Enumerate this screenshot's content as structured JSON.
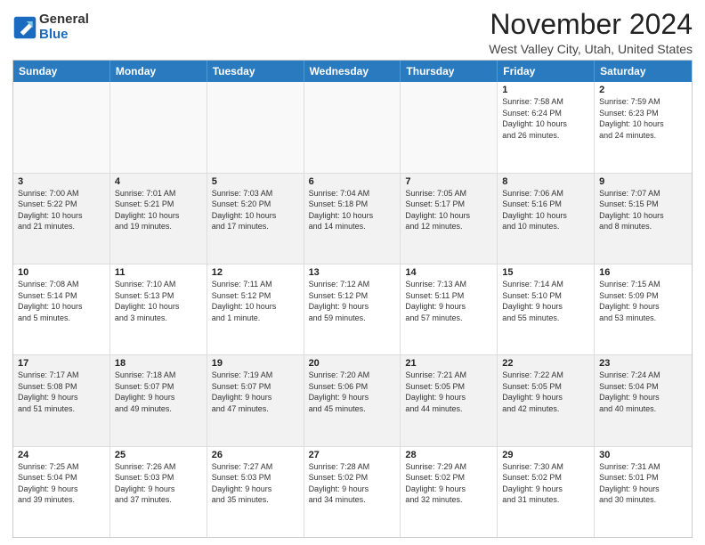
{
  "logo": {
    "general": "General",
    "blue": "Blue"
  },
  "title": "November 2024",
  "location": "West Valley City, Utah, United States",
  "header_days": [
    "Sunday",
    "Monday",
    "Tuesday",
    "Wednesday",
    "Thursday",
    "Friday",
    "Saturday"
  ],
  "weeks": [
    [
      {
        "day": "",
        "empty": true
      },
      {
        "day": "",
        "empty": true
      },
      {
        "day": "",
        "empty": true
      },
      {
        "day": "",
        "empty": true
      },
      {
        "day": "",
        "empty": true
      },
      {
        "day": "1",
        "info": "Sunrise: 7:58 AM\nSunset: 6:24 PM\nDaylight: 10 hours\nand 26 minutes."
      },
      {
        "day": "2",
        "info": "Sunrise: 7:59 AM\nSunset: 6:23 PM\nDaylight: 10 hours\nand 24 minutes."
      }
    ],
    [
      {
        "day": "3",
        "info": "Sunrise: 7:00 AM\nSunset: 5:22 PM\nDaylight: 10 hours\nand 21 minutes."
      },
      {
        "day": "4",
        "info": "Sunrise: 7:01 AM\nSunset: 5:21 PM\nDaylight: 10 hours\nand 19 minutes."
      },
      {
        "day": "5",
        "info": "Sunrise: 7:03 AM\nSunset: 5:20 PM\nDaylight: 10 hours\nand 17 minutes."
      },
      {
        "day": "6",
        "info": "Sunrise: 7:04 AM\nSunset: 5:18 PM\nDaylight: 10 hours\nand 14 minutes."
      },
      {
        "day": "7",
        "info": "Sunrise: 7:05 AM\nSunset: 5:17 PM\nDaylight: 10 hours\nand 12 minutes."
      },
      {
        "day": "8",
        "info": "Sunrise: 7:06 AM\nSunset: 5:16 PM\nDaylight: 10 hours\nand 10 minutes."
      },
      {
        "day": "9",
        "info": "Sunrise: 7:07 AM\nSunset: 5:15 PM\nDaylight: 10 hours\nand 8 minutes."
      }
    ],
    [
      {
        "day": "10",
        "info": "Sunrise: 7:08 AM\nSunset: 5:14 PM\nDaylight: 10 hours\nand 5 minutes."
      },
      {
        "day": "11",
        "info": "Sunrise: 7:10 AM\nSunset: 5:13 PM\nDaylight: 10 hours\nand 3 minutes."
      },
      {
        "day": "12",
        "info": "Sunrise: 7:11 AM\nSunset: 5:12 PM\nDaylight: 10 hours\nand 1 minute."
      },
      {
        "day": "13",
        "info": "Sunrise: 7:12 AM\nSunset: 5:12 PM\nDaylight: 9 hours\nand 59 minutes."
      },
      {
        "day": "14",
        "info": "Sunrise: 7:13 AM\nSunset: 5:11 PM\nDaylight: 9 hours\nand 57 minutes."
      },
      {
        "day": "15",
        "info": "Sunrise: 7:14 AM\nSunset: 5:10 PM\nDaylight: 9 hours\nand 55 minutes."
      },
      {
        "day": "16",
        "info": "Sunrise: 7:15 AM\nSunset: 5:09 PM\nDaylight: 9 hours\nand 53 minutes."
      }
    ],
    [
      {
        "day": "17",
        "info": "Sunrise: 7:17 AM\nSunset: 5:08 PM\nDaylight: 9 hours\nand 51 minutes."
      },
      {
        "day": "18",
        "info": "Sunrise: 7:18 AM\nSunset: 5:07 PM\nDaylight: 9 hours\nand 49 minutes."
      },
      {
        "day": "19",
        "info": "Sunrise: 7:19 AM\nSunset: 5:07 PM\nDaylight: 9 hours\nand 47 minutes."
      },
      {
        "day": "20",
        "info": "Sunrise: 7:20 AM\nSunset: 5:06 PM\nDaylight: 9 hours\nand 45 minutes."
      },
      {
        "day": "21",
        "info": "Sunrise: 7:21 AM\nSunset: 5:05 PM\nDaylight: 9 hours\nand 44 minutes."
      },
      {
        "day": "22",
        "info": "Sunrise: 7:22 AM\nSunset: 5:05 PM\nDaylight: 9 hours\nand 42 minutes."
      },
      {
        "day": "23",
        "info": "Sunrise: 7:24 AM\nSunset: 5:04 PM\nDaylight: 9 hours\nand 40 minutes."
      }
    ],
    [
      {
        "day": "24",
        "info": "Sunrise: 7:25 AM\nSunset: 5:04 PM\nDaylight: 9 hours\nand 39 minutes."
      },
      {
        "day": "25",
        "info": "Sunrise: 7:26 AM\nSunset: 5:03 PM\nDaylight: 9 hours\nand 37 minutes."
      },
      {
        "day": "26",
        "info": "Sunrise: 7:27 AM\nSunset: 5:03 PM\nDaylight: 9 hours\nand 35 minutes."
      },
      {
        "day": "27",
        "info": "Sunrise: 7:28 AM\nSunset: 5:02 PM\nDaylight: 9 hours\nand 34 minutes."
      },
      {
        "day": "28",
        "info": "Sunrise: 7:29 AM\nSunset: 5:02 PM\nDaylight: 9 hours\nand 32 minutes."
      },
      {
        "day": "29",
        "info": "Sunrise: 7:30 AM\nSunset: 5:02 PM\nDaylight: 9 hours\nand 31 minutes."
      },
      {
        "day": "30",
        "info": "Sunrise: 7:31 AM\nSunset: 5:01 PM\nDaylight: 9 hours\nand 30 minutes."
      }
    ]
  ]
}
